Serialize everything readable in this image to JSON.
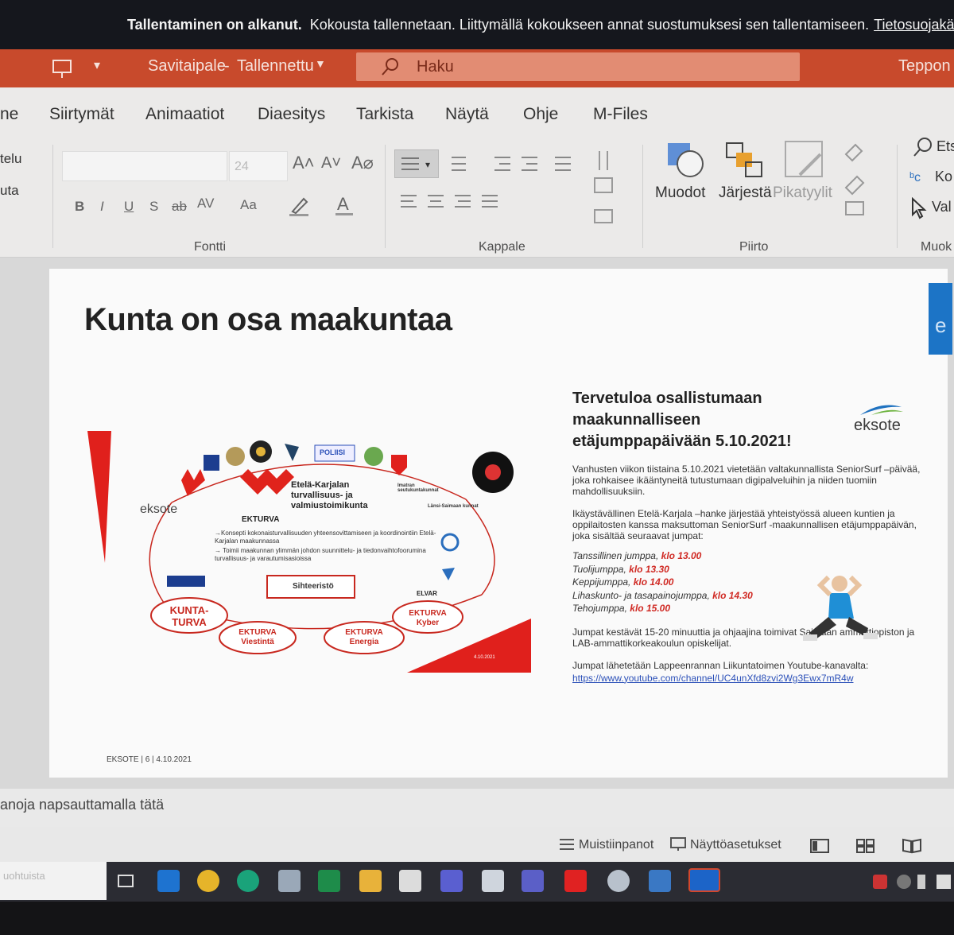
{
  "banner": {
    "bold": "Tallentaminen on alkanut.",
    "text": "Kokousta tallennetaan. Liittymällä kokoukseen annat suostumuksesi sen tallentamiseen.",
    "link": "Tietosuojakäytä"
  },
  "titlebar": {
    "doc": "Savitaipale",
    "separator": "-",
    "saved": "Tallennettu",
    "search_placeholder": "Haku",
    "user": "Teppon"
  },
  "tabs": [
    "ne",
    "Siirtymät",
    "Animaatiot",
    "Diaesitys",
    "Tarkista",
    "Näytä",
    "Ohje",
    "M-Files"
  ],
  "ribbon": {
    "left_items": [
      "telu",
      "uta"
    ],
    "font_size": "24",
    "groups": {
      "font": "Fontti",
      "paragraph": "Kappale",
      "drawing": "Piirto",
      "edit": "Muok"
    },
    "drawing_buttons": {
      "shapes": "Muodot",
      "arrange": "Järjestä",
      "quick_styles": "Pikatyylit"
    },
    "editing": [
      "Ets",
      "Ko",
      "Val"
    ],
    "format_letters": [
      "B",
      "I",
      "U",
      "S",
      "ab",
      "AV",
      "Aa"
    ]
  },
  "slide": {
    "title": "Kunta on osa maakuntaa",
    "side_letter": "e",
    "footer": "EKSOTE  |  6  |  4.10.2021",
    "diagram": {
      "org_title": "Etelä-Karjalan turvallisuus- ja valmiustoimikunta",
      "ekturva": "EKTURVA",
      "bullet1": "→Konsepti kokonaisturvallisuuden yhteensovittamiseen ja koordinointiin Etelä-Karjalan maakunnassa",
      "bullet2": "→ Toimii maakunnan ylimmän johdon suunnittelu- ja tiedonvaihtofoorumina turvallisuus- ja varautumisasioissa",
      "secretariat": "Sihteeristö",
      "eksote": "eksote",
      "poliisi": "POLIISI",
      "imatra": "Imatran seutukuntakunnat",
      "lansi": "Länsi-Saimaan kunnat",
      "elvar": "ELVAR",
      "ovals": [
        "KUNTA-\nTURVA",
        "EKTURVA\nViestintä",
        "EKTURVA\nEnergia",
        "EKTURVA\nKyber"
      ],
      "date_small": "4.10.2021"
    },
    "panel": {
      "heading": "Tervetuloa osallistumaan maakunnalliseen etäjumppapäivään 5.10.2021!",
      "logo": "eksote",
      "p1": "Vanhusten viikon tiistaina 5.10.2021 vietetään valtakunnallista SeniorSurf –päivää, joka rohkaisee ikääntyneitä tutustumaan digipalveluihin ja niiden tuomiin mahdollisuuksiin.",
      "p2": "Ikäystävällinen Etelä-Karjala –hanke järjestää yhteistyössä alueen kuntien ja oppilaitosten kanssa maksuttoman SeniorSurf -maakunnallisen etäjumppapäivän, joka sisältää seuraavat jumpat:",
      "sessions": [
        {
          "name": "Tanssillinen jumppa,",
          "time": "klo 13.00"
        },
        {
          "name": "Tuolijumppa,",
          "time": "klo 13.30"
        },
        {
          "name": "Keppijumppa,",
          "time": "klo 14.00"
        },
        {
          "name": "Lihaskunto- ja tasapainojumppa,",
          "time": "klo 14.30"
        },
        {
          "name": "Tehojumppa,",
          "time": "klo 15.00"
        }
      ],
      "p3": "Jumpat kestävät 15-20 minuuttia ja ohjaajina toimivat Saimaan ammattiopiston ja LAB-ammattikorkeakoulun opiskelijat.",
      "p4": "Jumpat lähetetään Lappeenrannan Liikuntatoimen Youtube-kanavalta:",
      "url": "https://www.youtube.com/channel/UC4unXfd8zvi2Wg3Ewx7mR4w"
    }
  },
  "notes_text": "anoja napsauttamalla tätä",
  "status": {
    "notes": "Muistiinpanot",
    "display": "Näyttöasetukset"
  },
  "taskbar": {
    "search_text": "uohtuista"
  },
  "colors": {
    "accent": "#c84a2c",
    "slide_red": "#e0201c",
    "link": "#2a4fb8",
    "taskbar": "#2b2c33"
  }
}
